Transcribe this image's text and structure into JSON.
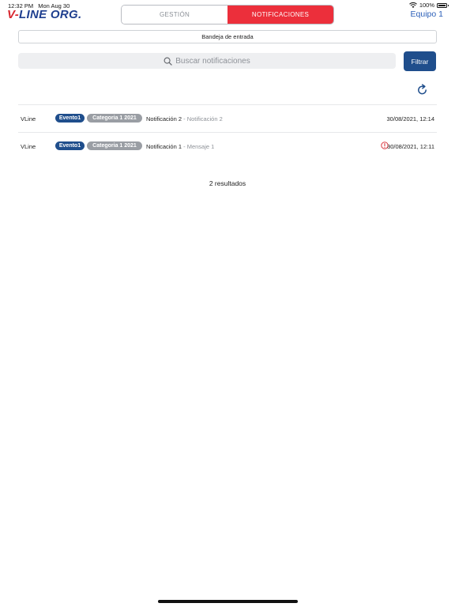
{
  "status_bar": {
    "time": "12:32 PM",
    "date": "Mon Aug 30",
    "battery_percent": "100%"
  },
  "header": {
    "logo_part1": "V-",
    "logo_part2": "LINE ORG.",
    "tabs": [
      {
        "label": "GESTIÓN",
        "active": false
      },
      {
        "label": "NOTIFICACIONES",
        "active": true
      }
    ],
    "team_label": "Equipo 1"
  },
  "inbox": {
    "label": "Bandeja de entrada"
  },
  "search": {
    "placeholder": "Buscar notificaciones"
  },
  "filter_button": {
    "label": "Filtrar"
  },
  "notifications": [
    {
      "sender": "VLine",
      "event_tag": "Evento1",
      "category_tag": "Categoria 1 2021",
      "title": "Notificación 2",
      "separator": "-",
      "subtitle": "Notificación 2",
      "date": "30/08/2021, 12:14",
      "alert": false
    },
    {
      "sender": "VLine",
      "event_tag": "Evento1",
      "category_tag": "Categoria 1 2021",
      "title": "Notificación 1",
      "separator": "-",
      "subtitle": "Mensaje 1",
      "date": "30/08/2021, 12:11",
      "alert": true
    }
  ],
  "results_text": "2 resultados",
  "colors": {
    "brand_blue": "#1f4e8c",
    "brand_red": "#ec2f3b",
    "link_blue": "#2b5fb8",
    "tag_gray": "#9a9ea4",
    "alert_red": "#d8262f"
  },
  "icons": [
    "wifi-icon",
    "battery-icon",
    "search-icon",
    "refresh-icon",
    "alert-icon"
  ]
}
